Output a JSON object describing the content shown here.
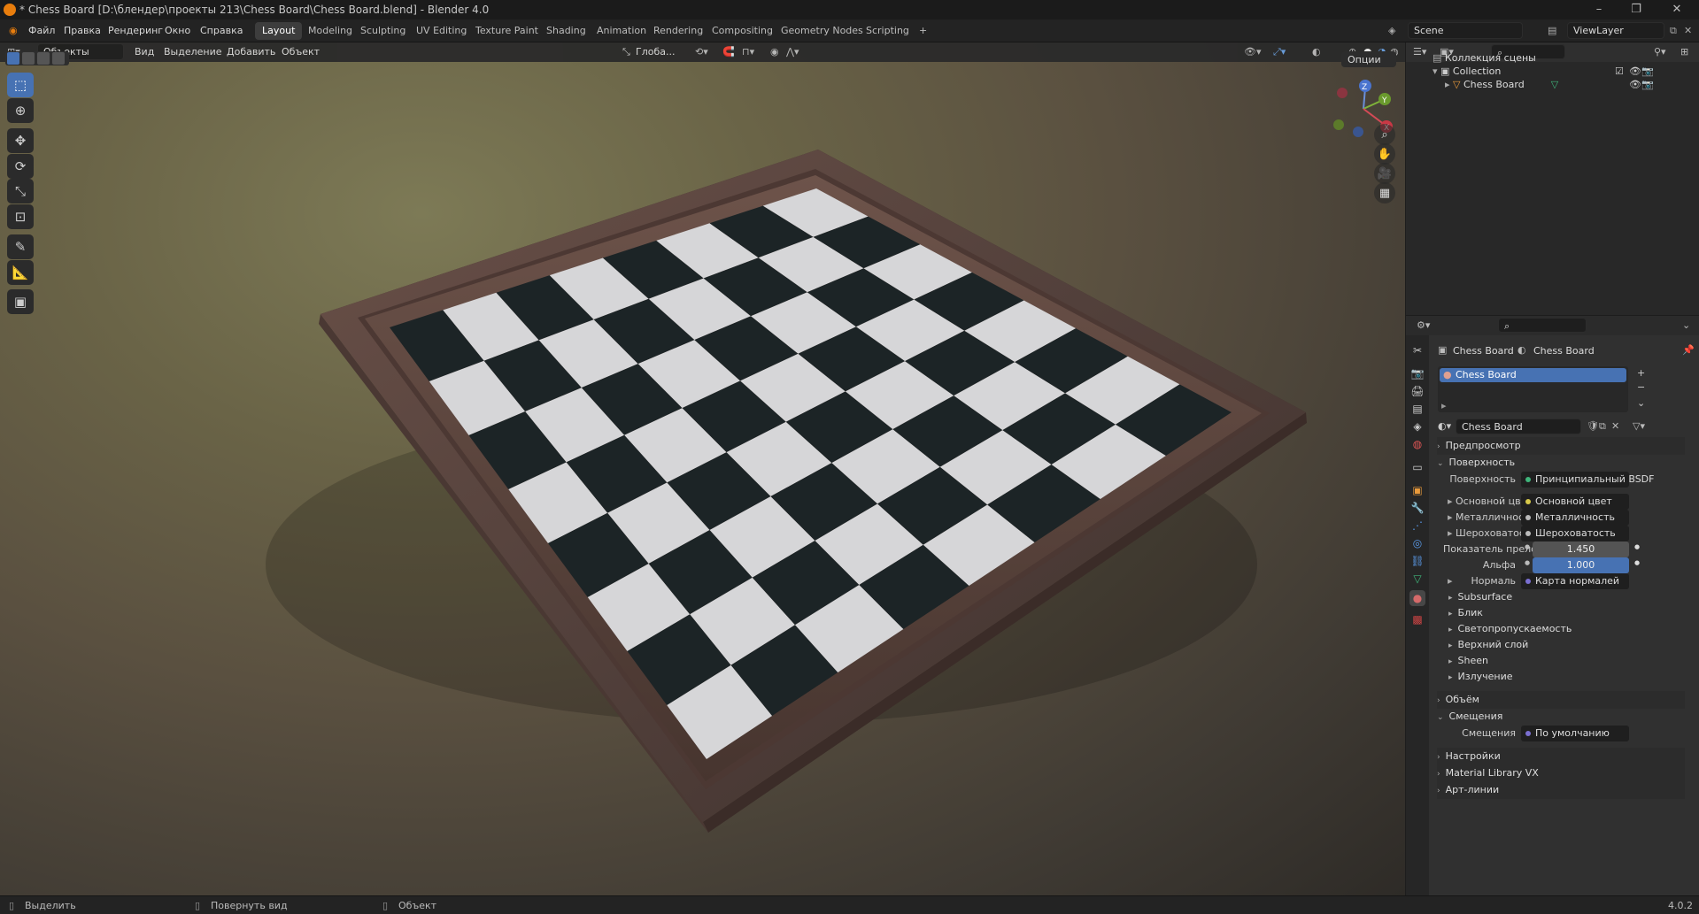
{
  "window": {
    "title": "* Chess Board [D:\\блендер\\проекты 213\\Chess Board\\Chess Board.blend] - Blender 4.0"
  },
  "menu": {
    "items": [
      "Файл",
      "Правка",
      "Рендеринг",
      "Окно",
      "Справка"
    ]
  },
  "workspaces": {
    "tabs": [
      "Layout",
      "Modeling",
      "Sculpting",
      "UV Editing",
      "Texture Paint",
      "Shading",
      "Animation",
      "Rendering",
      "Compositing",
      "Geometry Nodes",
      "Scripting"
    ],
    "add": "+"
  },
  "scene": {
    "name": "Scene"
  },
  "viewlayer": {
    "name": "ViewLayer"
  },
  "viewport_header": {
    "mode": "Объекты",
    "menus": [
      "Вид",
      "Выделение",
      "Добавить",
      "Объект"
    ],
    "orientation": "Глоба...",
    "options": "Опции"
  },
  "gizmo": {
    "z": "Z",
    "y": "Y",
    "x": "X"
  },
  "outliner": {
    "root": "Коллекция сцены",
    "collection": "Collection",
    "object": "Chess Board"
  },
  "properties": {
    "breadcrumb_object": "Chess Board",
    "breadcrumb_material": "Chess Board",
    "slot": "Chess Board",
    "material_name": "Chess Board",
    "sections": {
      "preview": "Предпросмотр",
      "surface": "Поверхность",
      "volume": "Объём",
      "displacement": "Смещения",
      "settings": "Настройки",
      "material_library": "Material Library VX",
      "lineart": "Арт-линии"
    },
    "surface_label": "Поверхность",
    "surface_value": "Принципиальный BSDF",
    "inputs": [
      {
        "label": "Основной цвет",
        "value": "Основной цвет"
      },
      {
        "label": "Металличность",
        "value": "Металличность"
      },
      {
        "label": "Шероховатость",
        "value": "Шероховатость"
      }
    ],
    "ior_label": "Показатель прело...",
    "ior_value": "1.450",
    "alpha_label": "Альфа",
    "alpha_value": "1.000",
    "normal_label": "Нормаль",
    "normal_value": "Карта нормалей",
    "subpanels": [
      "Subsurface",
      "Блик",
      "Светопропускаемость",
      "Верхний слой",
      "Sheen",
      "Излучение"
    ],
    "displacement_label": "Смещения",
    "displacement_value": "По умолчанию"
  },
  "status": {
    "select": "Выделить",
    "rotate": "Повернуть вид",
    "object": "Объект",
    "version": "4.0.2"
  },
  "colors": {
    "accent": "#4772b3",
    "board_light": "#d6d6d8",
    "board_dark": "#1c2426",
    "frame": "#5b4440"
  }
}
